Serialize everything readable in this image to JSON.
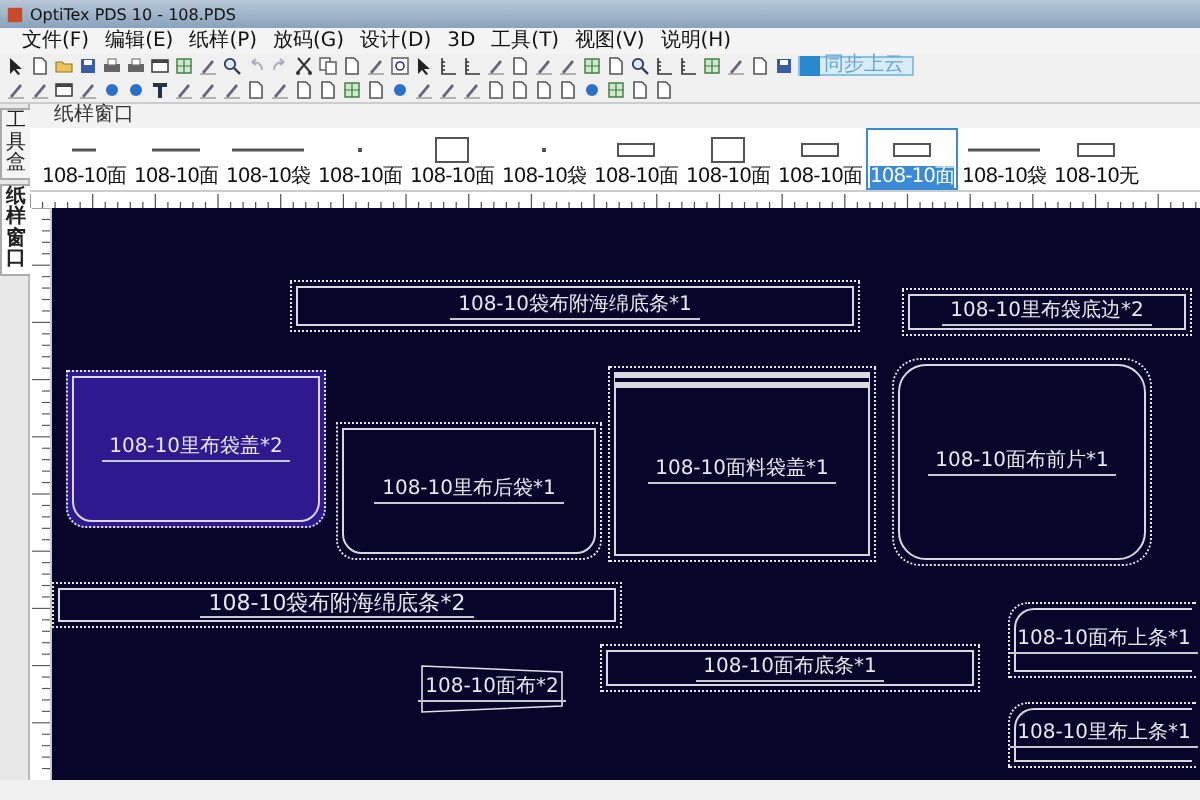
{
  "window": {
    "title": "OptiTex PDS 10 - 108.PDS"
  },
  "menu": [
    "文件(F)",
    "编辑(E)",
    "纸样(P)",
    "放码(G)",
    "设计(D)",
    "3D",
    "工具(T)",
    "视图(V)",
    "说明(H)"
  ],
  "cloud_button": {
    "label": "同步上云"
  },
  "side_tabs": [
    {
      "label": "工具盒",
      "selected": false
    },
    {
      "label": "纸样窗口",
      "selected": true
    }
  ],
  "pattern_window": {
    "title": "纸样窗口",
    "thumbnails": [
      {
        "label": "108-10面",
        "kind": "dash",
        "selected": false
      },
      {
        "label": "108-10面",
        "kind": "line",
        "selected": false
      },
      {
        "label": "108-10袋",
        "kind": "longline",
        "selected": false
      },
      {
        "label": "108-10面",
        "kind": "dot",
        "selected": false
      },
      {
        "label": "108-10面",
        "kind": "box",
        "selected": false
      },
      {
        "label": "108-10袋",
        "kind": "dot",
        "selected": false
      },
      {
        "label": "108-10面",
        "kind": "bar",
        "selected": false
      },
      {
        "label": "108-10面",
        "kind": "box",
        "selected": false
      },
      {
        "label": "108-10面",
        "kind": "bar",
        "selected": false
      },
      {
        "label": "108-10面",
        "kind": "bar",
        "selected": true
      },
      {
        "label": "108-10袋",
        "kind": "longline",
        "selected": false
      },
      {
        "label": "108-10无",
        "kind": "bar",
        "selected": false
      }
    ]
  },
  "pieces": [
    {
      "label": "108-10袋布附海绵底条*1",
      "kind": "strip",
      "selected": false
    },
    {
      "label": "108-10里布袋底边*2",
      "kind": "strip",
      "selected": false
    },
    {
      "label": "108-10里布袋盖*2",
      "kind": "rounded-bottom",
      "selected": true
    },
    {
      "label": "108-10里布后袋*1",
      "kind": "rounded-bottom",
      "selected": false
    },
    {
      "label": "108-10面料袋盖*1",
      "kind": "flap",
      "selected": false
    },
    {
      "label": "108-10面布前片*1",
      "kind": "rounded",
      "selected": false
    },
    {
      "label": "108-10袋布附海绵底条*2",
      "kind": "strip",
      "selected": false
    },
    {
      "label": "108-10面布*2",
      "kind": "trapezoid",
      "selected": false
    },
    {
      "label": "108-10面布底条*1",
      "kind": "strip",
      "selected": false
    },
    {
      "label": "108-10面布上条*1",
      "kind": "corner",
      "selected": false
    },
    {
      "label": "108-10里布上条*1",
      "kind": "corner",
      "selected": false
    }
  ]
}
